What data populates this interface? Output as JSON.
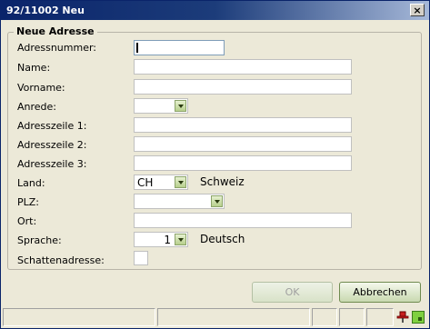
{
  "window": {
    "title": "92/11002 Neu",
    "close_glyph": "×"
  },
  "group": {
    "legend": "Neue Adresse"
  },
  "form": {
    "adressnummer": {
      "label": "Adressnummer:",
      "value": ""
    },
    "name": {
      "label": "Name:",
      "value": ""
    },
    "vorname": {
      "label": "Vorname:",
      "value": ""
    },
    "anrede": {
      "label": "Anrede:",
      "value": ""
    },
    "adresszeile1": {
      "label": "Adresszeile 1:",
      "value": ""
    },
    "adresszeile2": {
      "label": "Adresszeile 2:",
      "value": ""
    },
    "adresszeile3": {
      "label": "Adresszeile 3:",
      "value": ""
    },
    "land": {
      "label": "Land:",
      "value": "CH",
      "display": "Schweiz"
    },
    "plz": {
      "label": "PLZ:",
      "value": ""
    },
    "ort": {
      "label": "Ort:",
      "value": ""
    },
    "sprache": {
      "label": "Sprache:",
      "value": "1",
      "display": "Deutsch"
    },
    "schattenadresse": {
      "label": "Schattenadresse:",
      "value": ""
    }
  },
  "buttons": {
    "ok": "OK",
    "abbrechen": "Abbrechen"
  },
  "icons": {
    "pin": "pin-icon",
    "grip": "resize-grip-icon",
    "dropdown": "chevron-down-icon",
    "close": "close-icon"
  },
  "colors": {
    "titlebar": "#0a246a",
    "dialog_bg": "#ece9d8",
    "button_border": "#6f8a4f"
  }
}
